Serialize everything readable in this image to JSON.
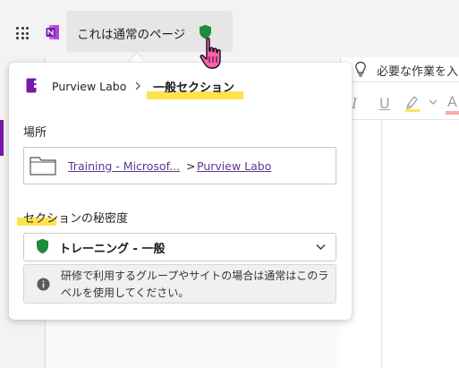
{
  "header": {
    "page_title": "これは通常のページ"
  },
  "toolbar": {
    "tell_me": "必要な作業を入"
  },
  "flyout": {
    "breadcrumb": {
      "notebook": "Purview Labo",
      "section": "一般セクション"
    },
    "location": {
      "label": "場所",
      "path_part1": "Training - Microsof...",
      "separator": ">",
      "path_part2": "Purview Labo"
    },
    "sensitivity": {
      "label": "セクションの秘密度",
      "selected_value": "トレーニング - 一般",
      "info_text": "研修で利用するグループやサイトの場合は通常はこのラベルを使用してください。"
    }
  },
  "colors": {
    "accent_purple": "#7719aa",
    "shield_green": "#1e8a3c",
    "highlight_yellow": "#ffe34d",
    "link_color": "#5b3a8e"
  },
  "icons": [
    "app-launcher-icon",
    "onenote-icon",
    "shield-icon",
    "pointer-cursor-icon",
    "lightbulb-icon",
    "notebook-icon",
    "folder-icon",
    "chevron-down-icon",
    "info-icon",
    "highlighter-icon"
  ]
}
